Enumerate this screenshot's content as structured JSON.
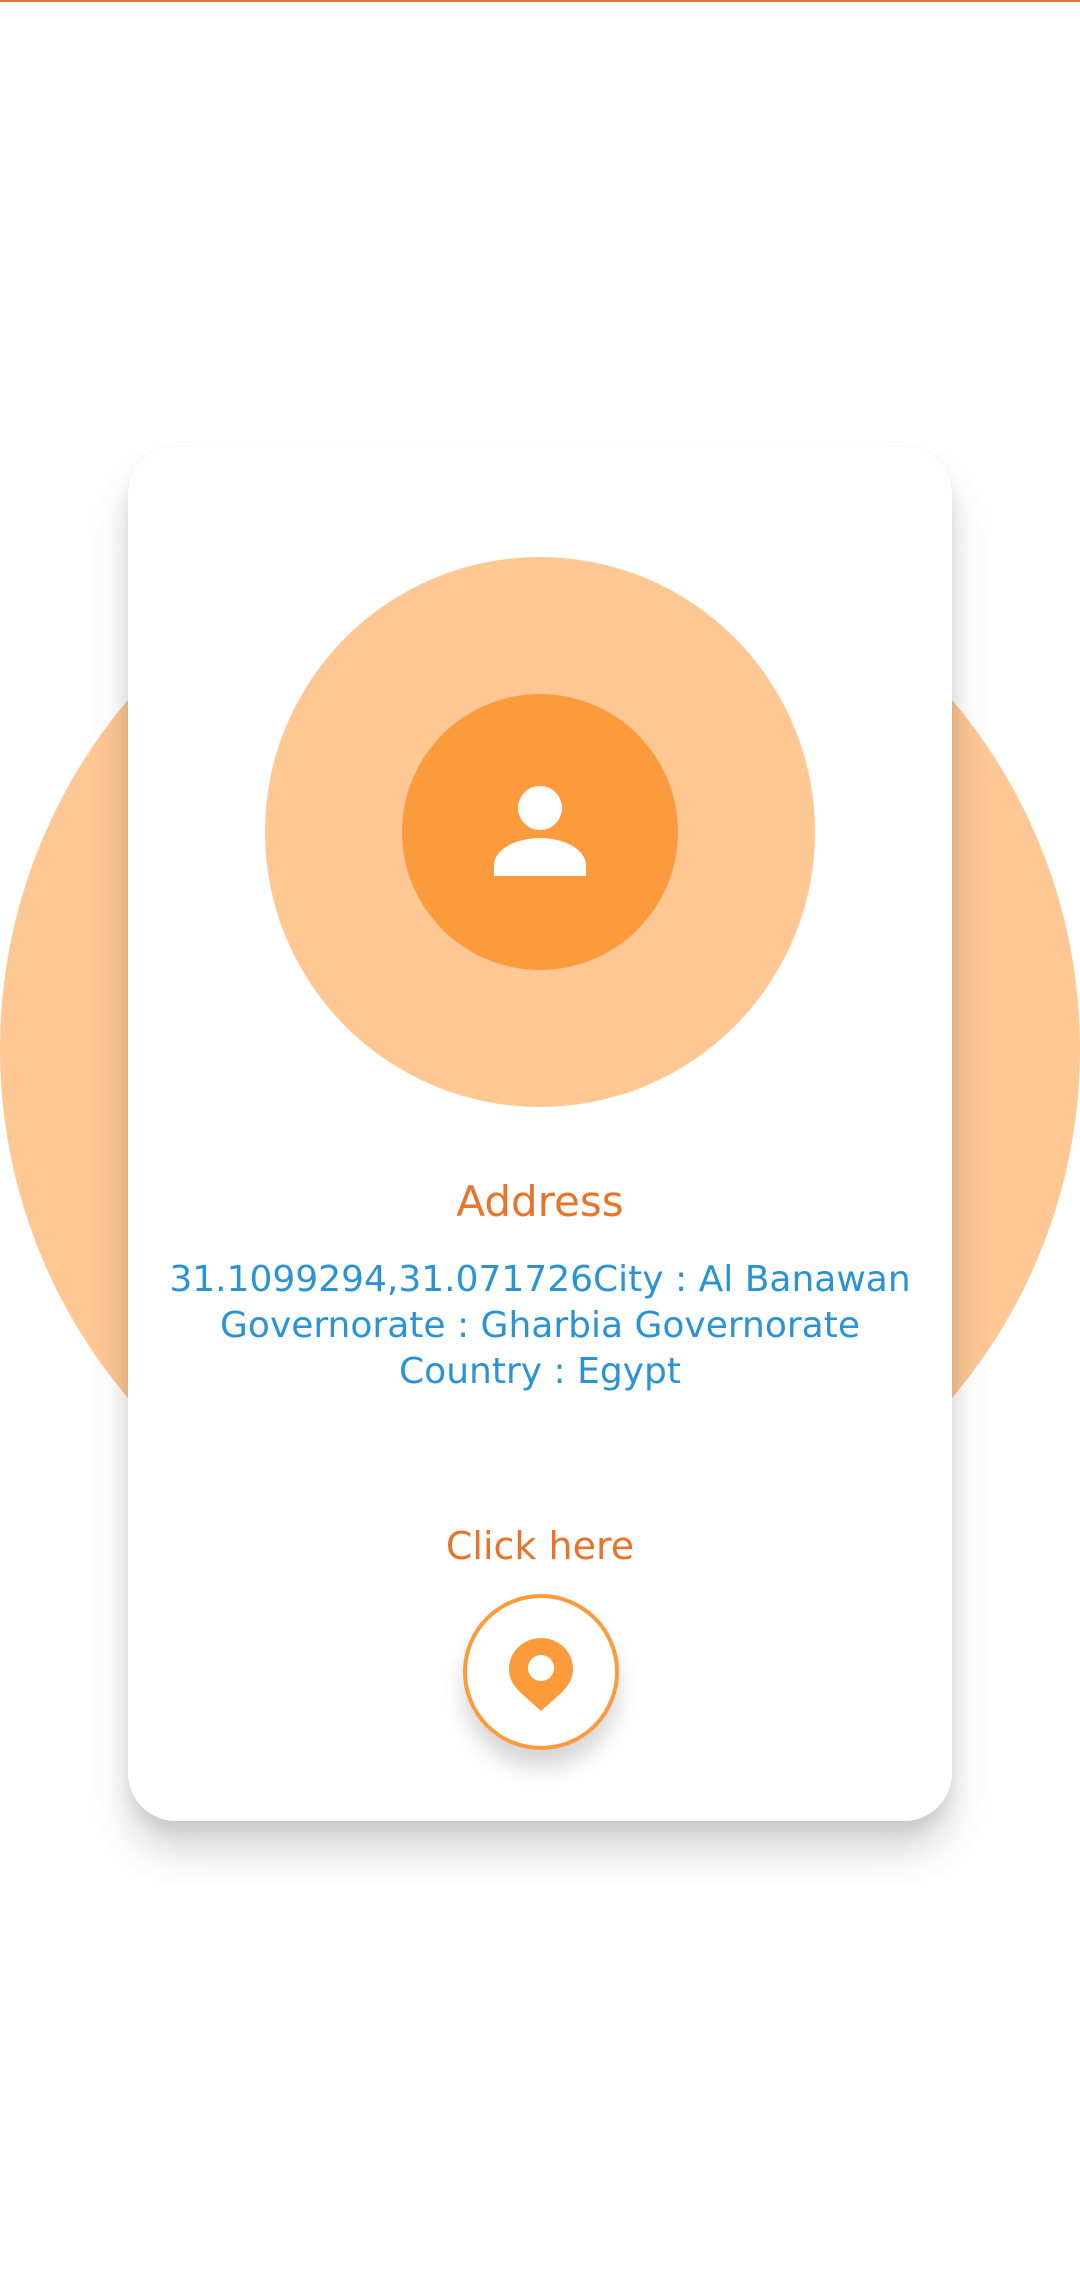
{
  "theme": {
    "accent": "#e8732a",
    "orange": "#fb9b3c",
    "peach": "#fec794",
    "link_blue": "#2a93d5"
  },
  "profile": {
    "avatar_icon": "person-icon"
  },
  "address": {
    "title": "Address",
    "line1": "31.1099294,31.071726City : Al Banawan",
    "line2": "Governorate : Gharbia Governorate",
    "line3": "Country : Egypt"
  },
  "action": {
    "label": "Click here",
    "icon": "location-pin-icon"
  }
}
